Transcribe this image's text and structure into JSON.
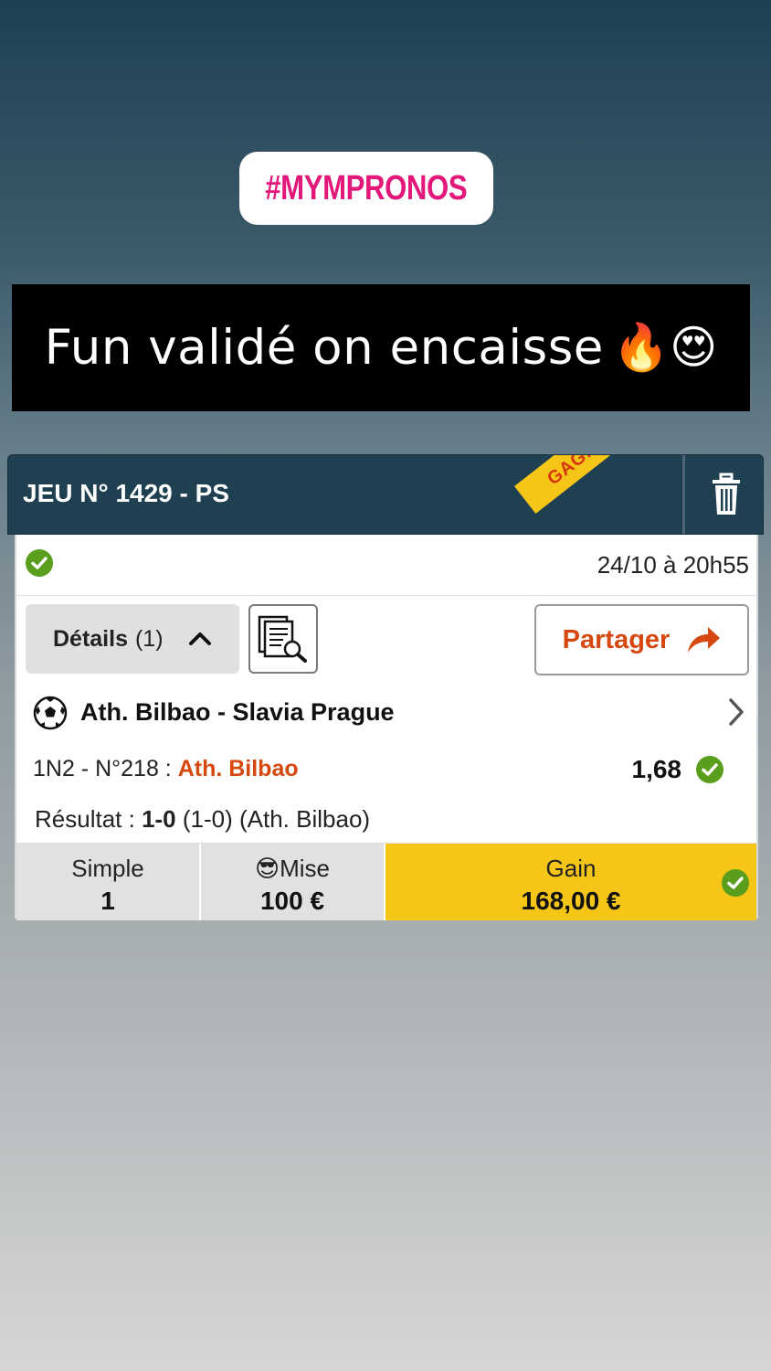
{
  "story": {
    "hashtag": "#MYMPRONOS",
    "caption": "Fun validé on encaisse",
    "caption_emojis": "🔥😍"
  },
  "ticket": {
    "title": "JEU N° 1429 - PS",
    "ribbon": "GAGNANT",
    "date": "24/10 à 20h55",
    "details_label": "Détails",
    "details_count": "(1)",
    "share_label": "Partager",
    "match": "Ath. Bilbao - Slavia Prague",
    "bet_prefix": "1N2 - N°218 :",
    "bet_pick": "Ath. Bilbao",
    "odds": "1,68",
    "result_prefix": "Résultat :",
    "result_score": "1-0",
    "result_detail": "(1-0) (Ath. Bilbao)",
    "summary": {
      "simple_label": "Simple",
      "simple_value": "1",
      "mise_emoji": "😎",
      "mise_label": "Mise",
      "mise_value": "100 €",
      "gain_label": "Gain",
      "gain_value": "168,00 €"
    }
  },
  "colors": {
    "header_bg": "#1f4051",
    "ribbon": "#f5c518",
    "accent_orange": "#d6480f",
    "hashtag_pink": "#e2197a",
    "success_green": "#5a9e1e"
  }
}
